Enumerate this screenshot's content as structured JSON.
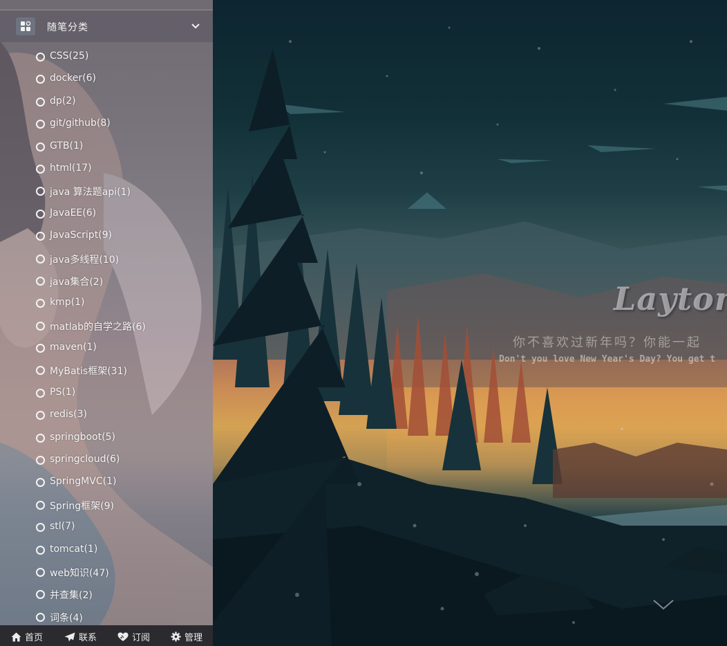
{
  "sidebar": {
    "header_title": "随笔分类",
    "categories": [
      "CSS(25)",
      "docker(6)",
      "dp(2)",
      "git/github(8)",
      "GTB(1)",
      "html(17)",
      "java 算法题api(1)",
      "JavaEE(6)",
      "JavaScript(9)",
      "java多线程(10)",
      "java集合(2)",
      "kmp(1)",
      "matlab的自学之路(6)",
      "maven(1)",
      "MyBatis框架(31)",
      "PS(1)",
      "redis(3)",
      "springboot(5)",
      "springcloud(6)",
      "SpringMVC(1)",
      "Spring框架(9)",
      "stl(7)",
      "tomcat(1)",
      "web知识(47)",
      "并查集(2)",
      "词条(4)"
    ]
  },
  "bottom_nav": {
    "home": "首页",
    "contact": "联系",
    "subscribe": "订阅",
    "manage": "管理"
  },
  "hero": {
    "brand": "Layton",
    "subtitle_cn": "你不喜欢过新年吗？你能一起",
    "subtitle_en": "Don't you love New Year's Day? You get t"
  },
  "icons": {
    "header": "grid-icon",
    "expand": "chevron-down-icon",
    "home": "home-icon",
    "contact": "paper-plane-icon",
    "subscribe": "heart-feed-icon",
    "manage": "gear-icon",
    "scroll": "chevron-down-icon"
  }
}
